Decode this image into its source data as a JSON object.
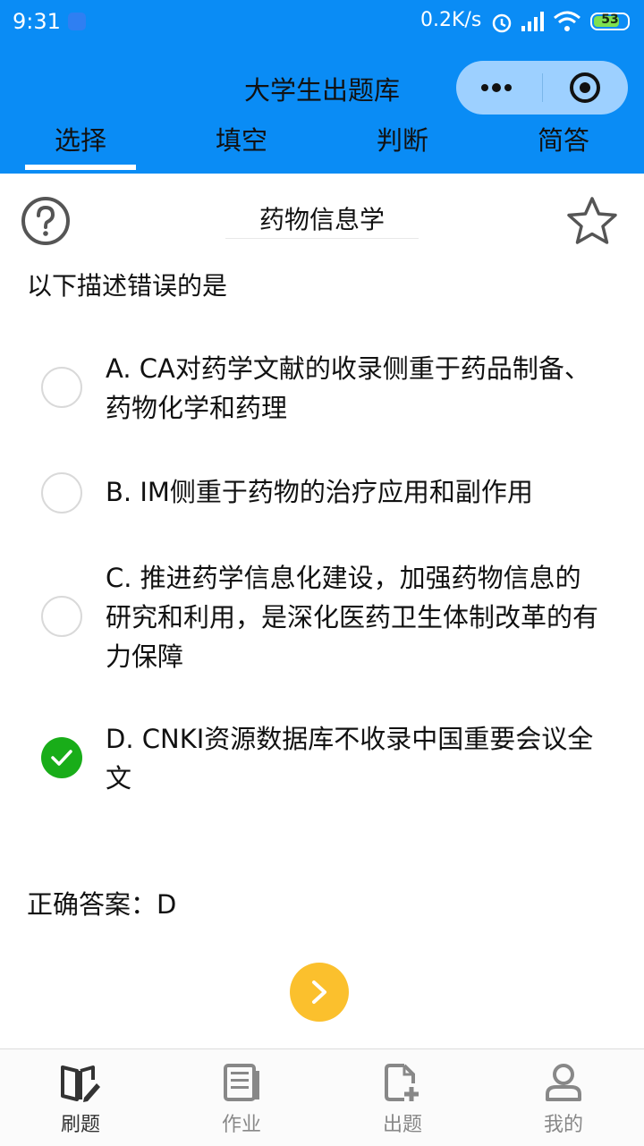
{
  "status_bar": {
    "time": "9:31",
    "net_speed": "0.2K/s",
    "battery_level": "53"
  },
  "header": {
    "title": "大学生出题库",
    "tabs": [
      {
        "label": "选择",
        "active": true
      },
      {
        "label": "填空",
        "active": false
      },
      {
        "label": "判断",
        "active": false
      },
      {
        "label": "简答",
        "active": false
      }
    ]
  },
  "question": {
    "subject": "药物信息学",
    "prompt": "以下描述错误的是",
    "options": [
      {
        "text": "A. CA对药学文献的收录侧重于药品制备、药物化学和药理",
        "selected": false
      },
      {
        "text": "B. IM侧重于药物的治疗应用和副作用",
        "selected": false
      },
      {
        "text": "C. 推进药学信息化建设，加强药物信息的研究和利用，是深化医药卫生体制改革的有力保障",
        "selected": false
      },
      {
        "text": "D. CNKI资源数据库不收录中国重要会议全文",
        "selected": true
      }
    ],
    "answer": "正确答案：D"
  },
  "bottom_nav": [
    {
      "label": "刷题",
      "icon": "book-pen-icon",
      "active": true
    },
    {
      "label": "作业",
      "icon": "document-icon",
      "active": false
    },
    {
      "label": "出题",
      "icon": "file-add-icon",
      "active": false
    },
    {
      "label": "我的",
      "icon": "user-icon",
      "active": false
    }
  ],
  "colors": {
    "primary": "#0a8cf5",
    "selected": "#19ad19",
    "next_button": "#fbc02d"
  }
}
